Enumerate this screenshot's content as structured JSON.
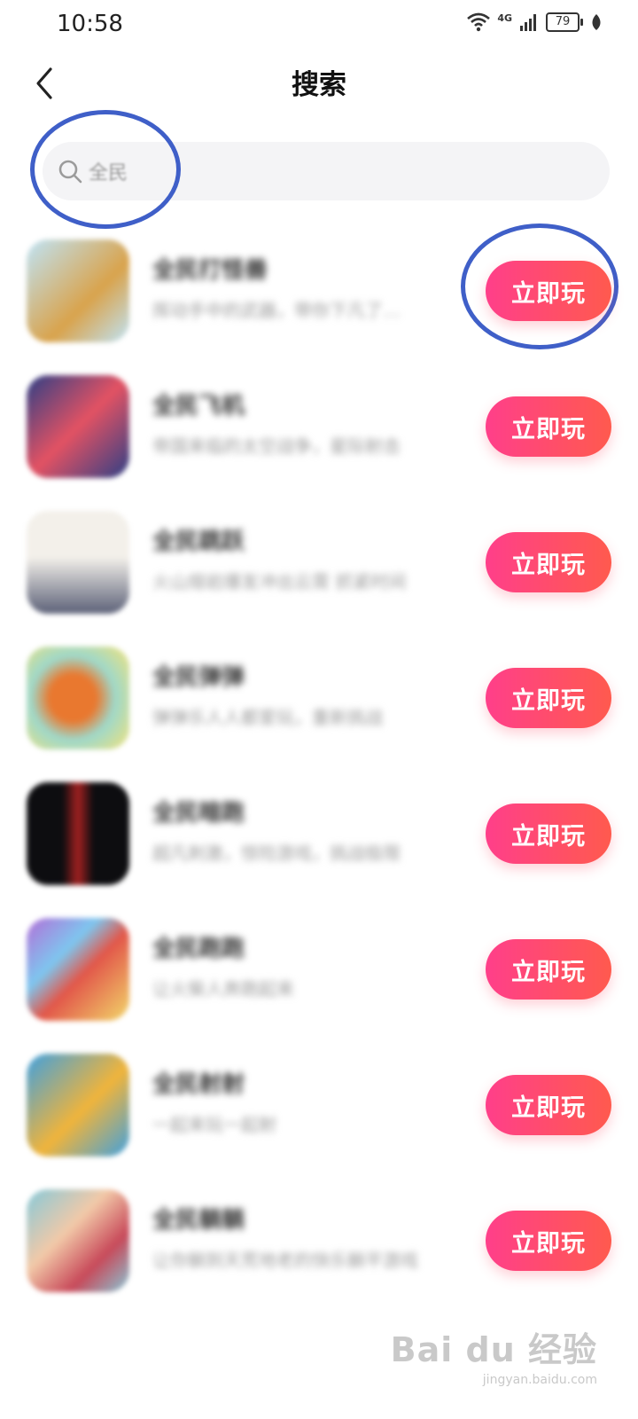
{
  "status": {
    "time": "10:58",
    "network": "4G",
    "battery": "79"
  },
  "header": {
    "title": "搜索"
  },
  "search": {
    "query": "全民"
  },
  "apps": [
    {
      "name": "全民打怪兽",
      "desc": "挥动手中的武器，带你下凡了…",
      "button": "立即玩",
      "icon_colors": [
        "#bfe4f7",
        "#d9a34c"
      ]
    },
    {
      "name": "全民飞机",
      "desc": "帝国来临的太空战争，星际射击",
      "button": "立即玩",
      "icon_colors": [
        "#2d3f86",
        "#e35263"
      ]
    },
    {
      "name": "全民跳跃",
      "desc": "火山熔岩爆发冲出云霄 抓紧时间",
      "button": "立即玩",
      "icon_colors": [
        "#f3f0ea",
        "#5c6178"
      ]
    },
    {
      "name": "全民弹弹",
      "desc": "弹弹乐人人都爱玩，重新挑战",
      "button": "立即玩",
      "icon_colors": [
        "#9fd8c9",
        "#e9782f"
      ]
    },
    {
      "name": "全民暗跑",
      "desc": "超凡刺激，惊险游戏，挑战极限",
      "button": "立即玩",
      "icon_colors": [
        "#0d0d10",
        "#a12020"
      ]
    },
    {
      "name": "全民跑跑",
      "desc": "让火柴人奔跑起来",
      "button": "立即玩",
      "icon_colors": [
        "#7ec6ef",
        "#e2574a"
      ]
    },
    {
      "name": "全民射射",
      "desc": "一起来玩一起射",
      "button": "立即玩",
      "icon_colors": [
        "#3fa0e0",
        "#f0b43b"
      ]
    },
    {
      "name": "全民躺躺",
      "desc": "让你躺到天荒地老的快乐躺平游戏",
      "button": "立即玩",
      "icon_colors": [
        "#86c9d9",
        "#c84a5a"
      ]
    }
  ],
  "watermark": {
    "main": "Bai du 经验",
    "sub": "jingyan.baidu.com"
  },
  "colors": {
    "button_gradient_start": "#ff3f8a",
    "button_gradient_end": "#ff5a4e",
    "annotation_circle": "#3f5fc8"
  }
}
